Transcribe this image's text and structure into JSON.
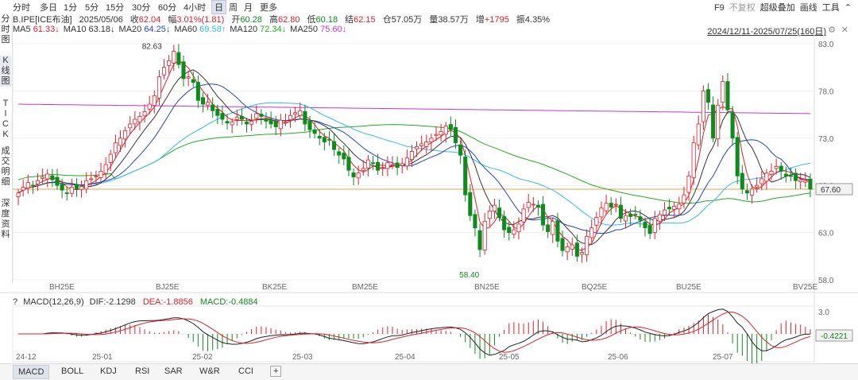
{
  "toolbar": {
    "periods": [
      "分时",
      "多日",
      "1分",
      "5分",
      "15分",
      "30分",
      "60分",
      "4小时",
      "日",
      "周",
      "月",
      "更多"
    ],
    "selected_period": "日",
    "right_items": [
      "F9",
      "不复权",
      "超级叠加",
      "画线",
      "工具"
    ]
  },
  "left_nav": [
    {
      "label": "分\n时\n图",
      "selected": false
    },
    {
      "label": "K\n线\n图",
      "selected": true
    },
    {
      "label": "T\nI\nC\nK",
      "selected": false
    },
    {
      "label": "成\n交\n明\n细",
      "selected": false
    },
    {
      "label": "深\n度\n资\n料",
      "selected": false
    }
  ],
  "info": {
    "symbol": "B.IPE[ICE布油]",
    "date": "2025/05/06",
    "close_label": "收",
    "close": "62.04",
    "change_label": "幅",
    "change": "3.01%(1.81)",
    "open_label": "开",
    "open": "60.28",
    "high_label": "高",
    "high": "62.80",
    "low_label": "低",
    "low": "60.18",
    "settle_label": "结",
    "settle": "62.15",
    "oi_label": "仓",
    "oi": "57.05万",
    "vol_label": "量",
    "vol": "38.57万",
    "inc_label": "增",
    "inc": "+1795",
    "amp_label": "振",
    "amp": "4.35%"
  },
  "ma_legend": [
    {
      "name": "MA5",
      "value": "61.33",
      "arrow": "↓",
      "color": "#e0202a"
    },
    {
      "name": "MA10",
      "value": "63.18",
      "arrow": "↓",
      "color": "#333333"
    },
    {
      "name": "MA20",
      "value": "64.25",
      "arrow": "↓",
      "color": "#2244cc"
    },
    {
      "name": "MA60",
      "value": "69.58",
      "arrow": "↑",
      "color": "#33bbee"
    },
    {
      "name": "MA120",
      "value": "72.34",
      "arrow": "↓",
      "color": "#22aa22"
    },
    {
      "name": "MA250",
      "value": "75.60",
      "arrow": "↓",
      "color": "#cc33cc"
    }
  ],
  "range_text": "2024/12/11-2025/07/25(160日)",
  "colors": {
    "up": "#e0202a",
    "down": "#0f8a1e",
    "ma5": "#e0202a",
    "ma10": "#333333",
    "ma20": "#2244cc",
    "ma60": "#33bbee",
    "ma120": "#22aa22",
    "ma250": "#cc33cc",
    "price_line": "#f0a040"
  },
  "price_axis": {
    "ticks": [
      "83.0",
      "78.0",
      "73.0",
      "68.0",
      "63.0",
      "58.0"
    ],
    "current": "67.60"
  },
  "annotations": {
    "high": "82.63",
    "low": "58.40"
  },
  "contract_labels": [
    "BH25E",
    "BJ25E",
    "BK25E",
    "BM25E",
    "BN25E",
    "BQ25E",
    "BU25E",
    "BV25E"
  ],
  "macd": {
    "title": "MACD(12,26,9)",
    "dif_label": "DIF:",
    "dif": "-2.1298",
    "dea_label": "DEA:",
    "dea": "-1.8856",
    "macd_label": "MACD:",
    "macd": "-0.4884",
    "axis_top": "3.0",
    "current": "-0.4221",
    "help_icon": "?"
  },
  "date_labels": [
    "24-12",
    "25-01",
    "25-02",
    "25-03",
    "25-04",
    "25-05",
    "25-06",
    "25-07"
  ],
  "bottom_tabs": [
    "MACD",
    "BOLL",
    "KDJ",
    "RSI",
    "SAR",
    "W&R",
    "CCI"
  ],
  "bottom_add_icon": "+",
  "chart_data": {
    "type": "candlestick",
    "y_range": [
      58.0,
      83.0
    ],
    "closes": [
      67.2,
      67.8,
      68.3,
      68.0,
      68.5,
      68.9,
      69.2,
      68.6,
      68.0,
      67.5,
      67.2,
      67.8,
      67.6,
      67.9,
      68.5,
      68.7,
      69.0,
      69.5,
      70.2,
      71.3,
      72.5,
      73.0,
      73.8,
      74.5,
      75.0,
      75.3,
      75.8,
      76.6,
      77.5,
      79.5,
      80.5,
      81.2,
      82.2,
      80.8,
      79.3,
      79.5,
      78.9,
      77.0,
      76.6,
      76.8,
      75.9,
      75.4,
      75.0,
      74.6,
      74.7,
      75.2,
      75.0,
      74.5,
      74.8,
      75.6,
      75.3,
      74.8,
      74.5,
      74.2,
      74.9,
      74.7,
      75.4,
      75.7,
      75.9,
      74.5,
      73.9,
      73.5,
      73.0,
      72.6,
      72.8,
      71.8,
      71.2,
      70.8,
      69.6,
      68.9,
      69.3,
      69.8,
      70.7,
      70.4,
      69.6,
      69.9,
      70.4,
      70.2,
      69.9,
      70.3,
      70.9,
      71.6,
      72.1,
      72.4,
      72.6,
      73.0,
      73.4,
      73.7,
      74.3,
      73.9,
      72.5,
      71.2,
      67.0,
      64.8,
      63.5,
      61.2,
      64.2,
      65.3,
      65.9,
      64.6,
      63.3,
      63.0,
      63.3,
      63.9,
      65.5,
      66.2,
      66.0,
      65.7,
      63.8,
      63.1,
      64.2,
      62.1,
      61.1,
      61.5,
      61.7,
      60.5,
      60.9,
      62.6,
      63.5,
      64.6,
      65.6,
      66.1,
      65.7,
      66.0,
      64.5,
      64.8,
      64.7,
      64.9,
      64.3,
      63.5,
      62.9,
      64.5,
      64.9,
      65.4,
      65.5,
      65.8,
      66.0,
      67.0,
      69.0,
      72.5,
      74.5,
      78.0,
      76.8,
      73.0,
      76.5,
      79.0,
      76.0,
      73.0,
      69.0,
      67.6,
      67.2,
      67.6,
      68.0,
      68.7,
      69.3,
      69.5,
      70.0,
      69.5,
      69.0,
      69.0,
      68.5,
      68.6,
      68.5,
      67.6
    ],
    "ma250": [
      76.6,
      75.6
    ],
    "macd_axis_top": 3.0
  }
}
